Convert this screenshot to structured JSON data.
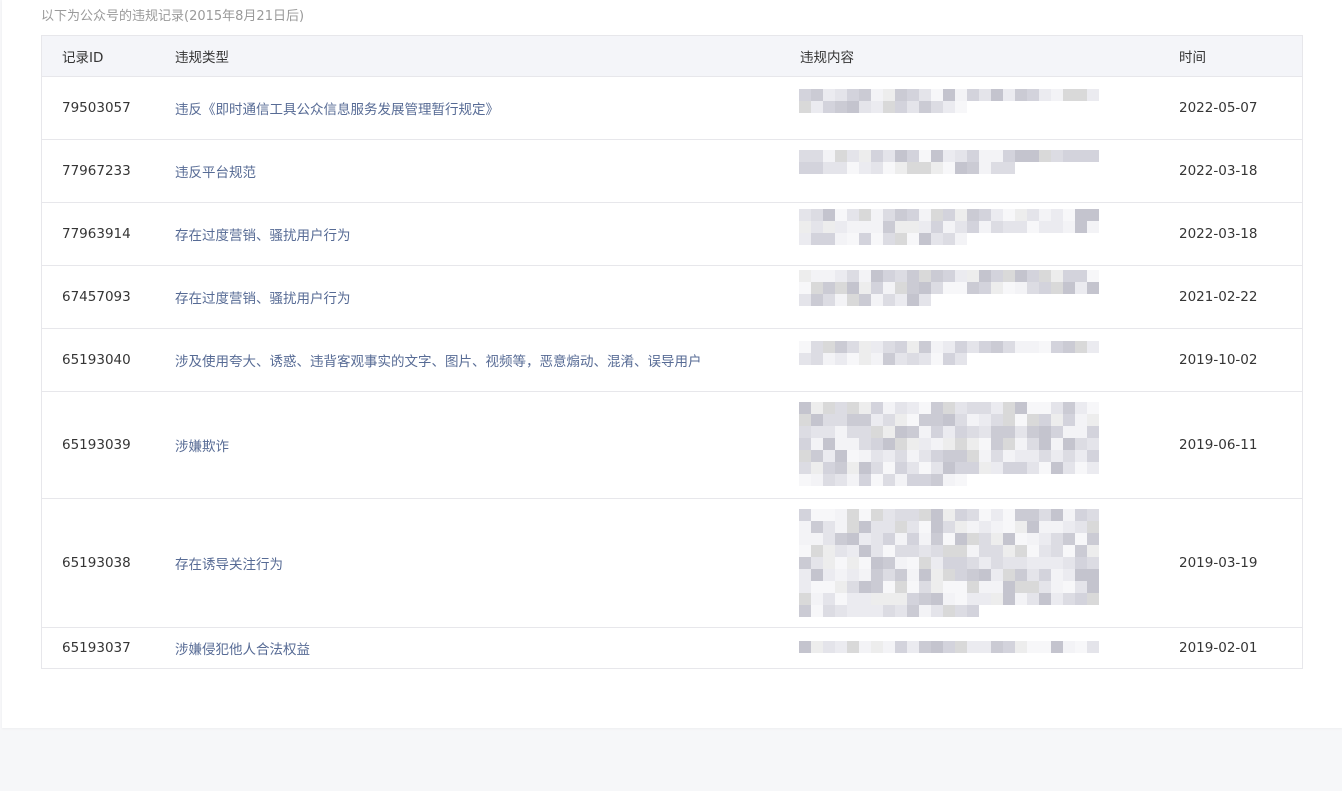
{
  "intro": "以下为公众号的违规记录(2015年8月21日后)",
  "columns": {
    "id": "记录ID",
    "type": "违规类型",
    "content": "违规内容",
    "date": "时间"
  },
  "rows": [
    {
      "id": "79503057",
      "type": "违反《即时通信工具公众信息服务发展管理暂行规定》",
      "date": "2022-05-07",
      "content_lines": 2
    },
    {
      "id": "77967233",
      "type": "违反平台规范",
      "date": "2022-03-18",
      "content_lines": 2
    },
    {
      "id": "77963914",
      "type": "存在过度营销、骚扰用户行为",
      "date": "2022-03-18",
      "content_lines": 3
    },
    {
      "id": "67457093",
      "type": "存在过度营销、骚扰用户行为",
      "date": "2021-02-22",
      "content_lines": 3
    },
    {
      "id": "65193040",
      "type": "涉及使用夸大、诱惑、违背客观事实的文字、图片、视频等，恶意煽动、混淆、误导用户",
      "date": "2019-10-02",
      "content_lines": 2
    },
    {
      "id": "65193039",
      "type": "涉嫌欺诈",
      "date": "2019-06-11",
      "content_lines": 7
    },
    {
      "id": "65193038",
      "type": "存在诱导关注行为",
      "date": "2019-03-19",
      "content_lines": 9
    },
    {
      "id": "65193037",
      "type": "涉嫌侵犯他人合法权益",
      "date": "2019-02-01",
      "content_lines": 1
    }
  ],
  "content_state": "pixelated"
}
